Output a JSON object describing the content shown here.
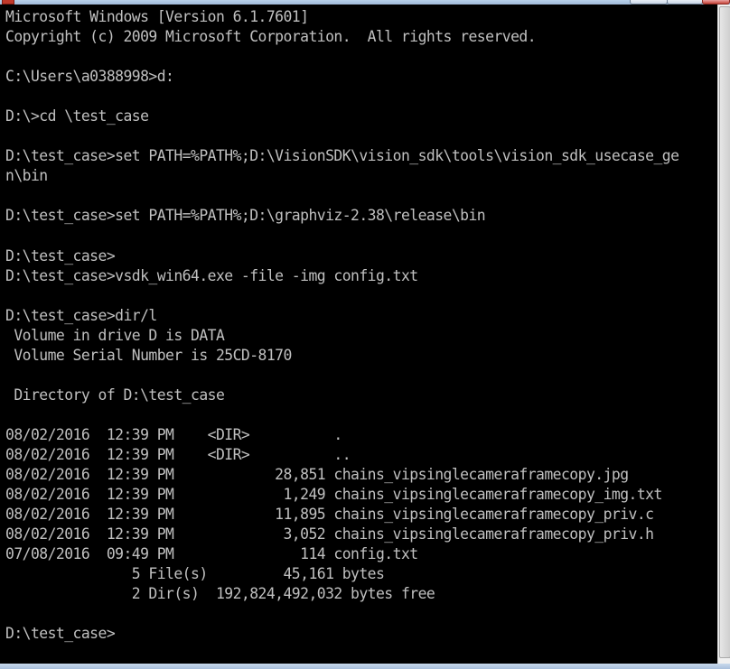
{
  "console": {
    "lines": [
      "Microsoft Windows [Version 6.1.7601]",
      "Copyright (c) 2009 Microsoft Corporation.  All rights reserved.",
      "",
      "C:\\Users\\a0388998>d:",
      "",
      "D:\\>cd \\test_case",
      "",
      "D:\\test_case>set PATH=%PATH%;D:\\VisionSDK\\vision_sdk\\tools\\vision_sdk_usecase_ge",
      "n\\bin",
      "",
      "D:\\test_case>set PATH=%PATH%;D:\\graphviz-2.38\\release\\bin",
      "",
      "D:\\test_case>",
      "D:\\test_case>vsdk_win64.exe -file -img config.txt",
      "",
      "D:\\test_case>dir/l",
      " Volume in drive D is DATA",
      " Volume Serial Number is 25CD-8170",
      "",
      " Directory of D:\\test_case",
      "",
      "08/02/2016  12:39 PM    <DIR>          .",
      "08/02/2016  12:39 PM    <DIR>          ..",
      "08/02/2016  12:39 PM            28,851 chains_vipsinglecameraframecopy.jpg",
      "08/02/2016  12:39 PM             1,249 chains_vipsinglecameraframecopy_img.txt",
      "08/02/2016  12:39 PM            11,895 chains_vipsinglecameraframecopy_priv.c",
      "08/02/2016  12:39 PM             3,052 chains_vipsinglecameraframecopy_priv.h",
      "07/08/2016  09:49 PM               114 config.txt",
      "               5 File(s)         45,161 bytes",
      "               2 Dir(s)  192,824,492,032 bytes free",
      "",
      "D:\\test_case>"
    ]
  },
  "colors": {
    "background": "#000000",
    "text": "#c0c0c0"
  },
  "icons": {
    "app": "console-app-icon",
    "minimize": "minimize-icon",
    "maximize": "maximize-icon",
    "close": "close-icon"
  }
}
